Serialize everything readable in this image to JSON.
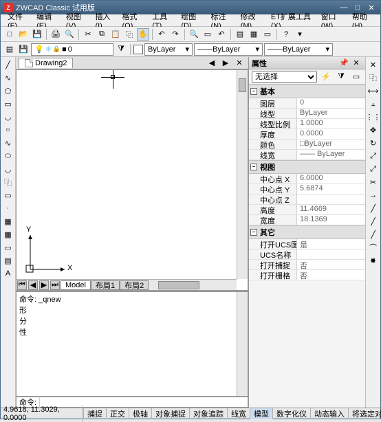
{
  "titlebar": {
    "app_name": "ZWCAD Classic 试用版"
  },
  "menus": [
    "文件(F)",
    "编辑(E)",
    "视图(V)",
    "插入(I)",
    "格式(O)",
    "工具(T)",
    "绘图(D)",
    "标注(N)",
    "修改(M)",
    "ET扩展工具(X)",
    "窗口(W)",
    "帮助(H)"
  ],
  "layer_controls": {
    "layer": "ByLayer",
    "linetype": "ByLayer",
    "lineweight": "ByLayer"
  },
  "doc": {
    "name": "Drawing2"
  },
  "sheet_tabs": {
    "model": "Model",
    "layout1": "布局1",
    "layout2": "布局2"
  },
  "ucs": {
    "x": "X",
    "y": "Y"
  },
  "properties": {
    "panel_title": "属性",
    "selection": "无选择",
    "groups": {
      "basic": {
        "label": "基本",
        "rows": [
          {
            "k": "图层",
            "v": "0"
          },
          {
            "k": "线型",
            "v": "ByLayer"
          },
          {
            "k": "线型比例",
            "v": "1.0000"
          },
          {
            "k": "厚度",
            "v": "0.0000"
          },
          {
            "k": "颜色",
            "v": "□ByLayer"
          },
          {
            "k": "线宽",
            "v": "—— ByLayer"
          }
        ]
      },
      "view": {
        "label": "视图",
        "rows": [
          {
            "k": "中心点 X",
            "v": "6.0000"
          },
          {
            "k": "中心点 Y",
            "v": "5.6874"
          },
          {
            "k": "中心点 Z",
            "v": ""
          },
          {
            "k": "高度",
            "v": "11.4669"
          },
          {
            "k": "宽度",
            "v": "18.1369"
          }
        ]
      },
      "other": {
        "label": "其它",
        "rows": [
          {
            "k": "打开UCS图标",
            "v": "是"
          },
          {
            "k": "UCS名称",
            "v": ""
          },
          {
            "k": "打开捕捉",
            "v": "否"
          },
          {
            "k": "打开栅格",
            "v": "否"
          }
        ]
      }
    }
  },
  "command": {
    "output": "命令: _qnew\n形\n分\n性",
    "prompt": "命令:"
  },
  "status": {
    "coords": "4.9618, 11.3029, 0.0000",
    "buttons": [
      "捕捉",
      "正交",
      "极轴",
      "对象捕捉",
      "对象追踪",
      "线宽",
      "模型",
      "数字化仪",
      "动态输入",
      "将选定对象的特性"
    ],
    "active_idx": 6
  },
  "icons": {
    "minimize": "—",
    "maximize": "□",
    "close": "✕",
    "restore": "❐",
    "new": "□",
    "open": "📂",
    "save": "💾",
    "print": "🖨",
    "cut": "✂",
    "copy": "⧉",
    "paste": "📋",
    "undo": "↶",
    "redo": "↷",
    "pan": "✋",
    "zoom": "🔍",
    "bulb": "💡",
    "freeze": "❄",
    "lock": "🔒",
    "line": "╱",
    "rect": "▭",
    "circle": "○",
    "arc": "◡",
    "poly": "⬠",
    "ellipse": "⬭",
    "spline": "∿",
    "point": "·",
    "hatch": "▦",
    "text": "A",
    "table": "▤",
    "dim": "⟷",
    "move": "✥",
    "copy2": "⿻",
    "rotate": "↻",
    "mirror": "⟷",
    "scale": "⤢",
    "trim": "✂",
    "extend": "→",
    "offset": "⫠",
    "fillet": "⌒",
    "array": "⋮⋮",
    "erase": "✕",
    "explode": "✸",
    "flash": "⚡",
    "filter": "⧩",
    "arrow_l": "◀",
    "arrow_r": "▶",
    "arrow_ll": "⏮",
    "arrow_rr": "⏭",
    "minus": "−",
    "dd": "▾"
  }
}
